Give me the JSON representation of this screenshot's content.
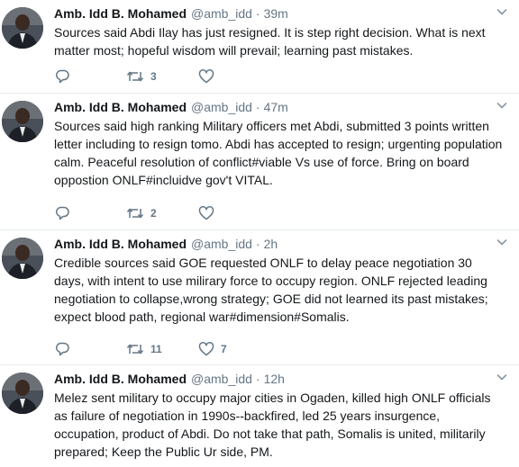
{
  "tweets": [
    {
      "name": "Amb. Idd B. Mohamed",
      "handle": "@amb_idd",
      "separator": "·",
      "time": "39m",
      "text": "Sources said Abdi Ilay has just resigned. It is step right decision. What is next matter most; hopeful wisdom will prevail; learning past mistakes.",
      "retweets": "3",
      "likes": ""
    },
    {
      "name": "Amb. Idd B. Mohamed",
      "handle": "@amb_idd",
      "separator": "·",
      "time": "47m",
      "text": "Sources said high ranking Military officers met Abdi, submitted 3 points written letter including to resign tomo. Abdi has accepted to resign; urgenting population calm. Peaceful resolution of conflict#viable Vs use of force. Bring on board oppostion ONLF#incluidve gov't VITAL.",
      "retweets": "2",
      "likes": ""
    },
    {
      "name": "Amb. Idd B. Mohamed",
      "handle": "@amb_idd",
      "separator": "·",
      "time": "2h",
      "text": "Credible sources said GOE requested ONLF to delay peace negotiation 30 days, with intent to use milirary force to occupy region. ONLF rejected leading negotiation to collapse,wrong strategy; GOE did not learned its past mistakes; expect blood path, regional war#dimension#Somalis.",
      "retweets": "11",
      "likes": "7"
    },
    {
      "name": "Amb. Idd B. Mohamed",
      "handle": "@amb_idd",
      "separator": "·",
      "time": "12h",
      "text": "Melez sent military to occupy major cities in Ogaden, killed high ONLF officials as failure of negotiation in 1990s--backfired, led 25 years insurgence, occupation, product of Abdi. Do not take that path, Somalis is united, militarily prepared; Keep the  Public Ur side, PM.",
      "retweets": "",
      "likes": ""
    }
  ],
  "icons": {
    "reply": "reply-icon",
    "retweet": "retweet-icon",
    "like": "heart-icon",
    "caret": "chevron-down-icon"
  },
  "colors": {
    "text": "#14171a",
    "secondary": "#657786",
    "divider": "#e6ecf0"
  }
}
